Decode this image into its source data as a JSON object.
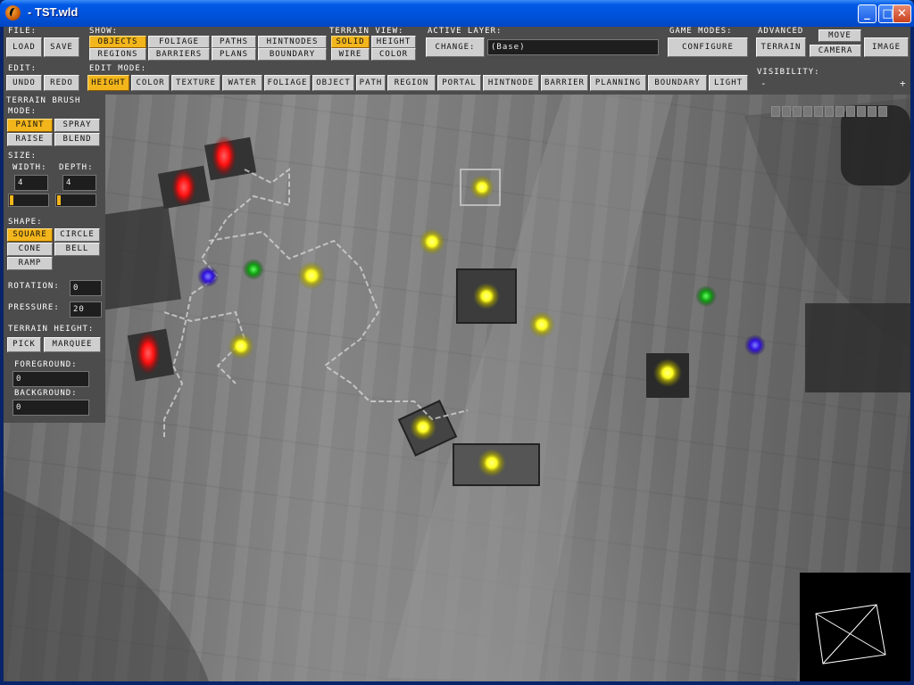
{
  "window": {
    "title": "- TST.wld"
  },
  "toolbar": {
    "file": {
      "label": "File:",
      "load": "Load",
      "save": "Save"
    },
    "show": {
      "label": "Show:",
      "items": [
        "Objects",
        "Foliage",
        "Paths",
        "HintNodes",
        "Regions",
        "Barriers",
        "Plans",
        "Boundary"
      ],
      "selected": "Objects"
    },
    "terrain_view": {
      "label": "Terrain View:",
      "items": [
        "Solid",
        "Height",
        "Wire",
        "Color"
      ],
      "selected": "Solid"
    },
    "active_layer": {
      "label": "Active Layer:",
      "change": "Change:",
      "value": "(Base)"
    },
    "game_modes": {
      "label": "Game Modes:",
      "configure": "Configure"
    },
    "advanced": {
      "label": "Advanced",
      "terrain": "Terrain",
      "move": "Move",
      "camera": "Camera",
      "image": "Image"
    },
    "edit": {
      "label": "Edit:",
      "undo": "Undo",
      "redo": "Redo"
    },
    "edit_mode": {
      "label": "Edit Mode:",
      "items": [
        "Height",
        "Color",
        "Texture",
        "Water",
        "Foliage",
        "Object",
        "Path",
        "Region",
        "Portal",
        "HintNode",
        "Barrier",
        "Planning",
        "Boundary",
        "Light"
      ],
      "selected": "Height"
    },
    "visibility": {
      "label": "Visibility:",
      "minus": "-",
      "plus": "+"
    }
  },
  "brush": {
    "title": "Terrain Brush",
    "mode_label": "Mode:",
    "modes": [
      "Paint",
      "Spray",
      "Raise",
      "Blend"
    ],
    "selected_mode": "Paint",
    "size_label": "Size:",
    "width_label": "Width:",
    "depth_label": "Depth:",
    "width": "4",
    "depth": "4",
    "shape_label": "Shape:",
    "shapes": [
      "Square",
      "Circle",
      "Cone",
      "Bell",
      "Ramp"
    ],
    "selected_shape": "Square",
    "rotation_label": "Rotation:",
    "rotation": "0",
    "pressure_label": "Pressure:",
    "pressure": "20",
    "terrain_height_label": "Terrain Height:",
    "pick": "Pick",
    "marquee": "Marquee",
    "foreground_label": "Foreground:",
    "foreground": "0",
    "background_label": "Background:",
    "background": "0"
  },
  "colors": {
    "panel": "#4c4c4c",
    "button": "#cfcfcf",
    "selected": "#f2b51b",
    "field": "#1e1e1e",
    "light_yellow": "#ffff30",
    "light_red": "#ff1010",
    "light_green": "#20c020",
    "light_blue": "#3a20ff"
  }
}
